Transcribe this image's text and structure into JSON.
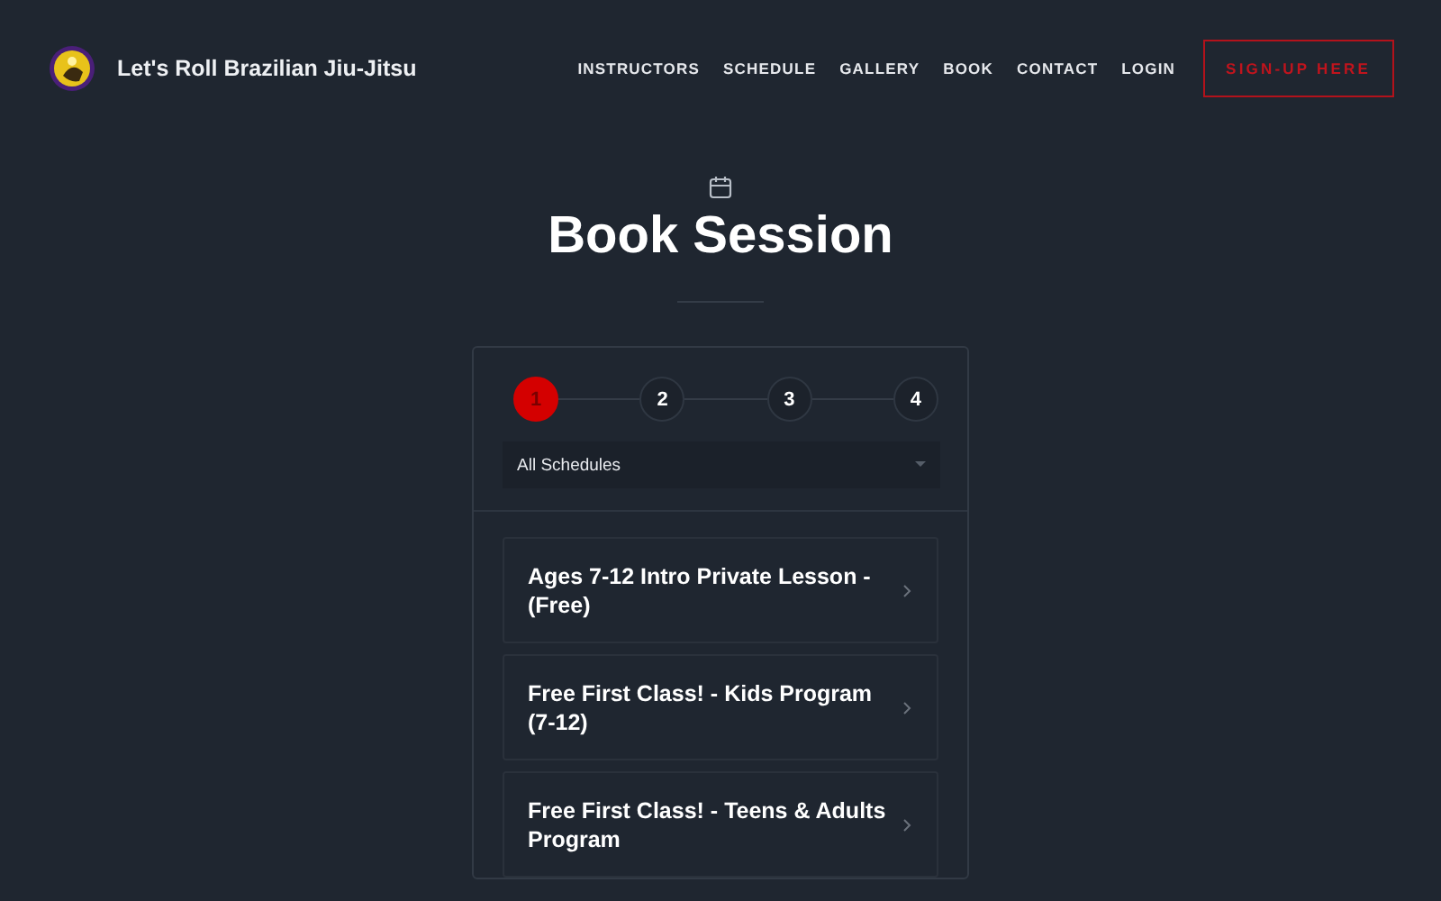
{
  "header": {
    "brand": "Let's Roll Brazilian Jiu-Jitsu",
    "nav": [
      {
        "label": "INSTRUCTORS"
      },
      {
        "label": "SCHEDULE"
      },
      {
        "label": "GALLERY"
      },
      {
        "label": "BOOK"
      },
      {
        "label": "CONTACT"
      },
      {
        "label": "LOGIN"
      }
    ],
    "cta": "SIGN-UP HERE"
  },
  "title": "Book Session",
  "steps": [
    {
      "label": "1",
      "selected": true
    },
    {
      "label": "2",
      "selected": false
    },
    {
      "label": "3",
      "selected": false
    },
    {
      "label": "4",
      "selected": false
    }
  ],
  "schedule_select": {
    "value": "All Schedules"
  },
  "sessions": [
    {
      "title": "Ages 7-12 Intro Private Lesson - (Free)"
    },
    {
      "title": "Free First Class! - Kids Program (7-12)"
    },
    {
      "title": "Free First Class! - Teens & Adults Program"
    }
  ]
}
